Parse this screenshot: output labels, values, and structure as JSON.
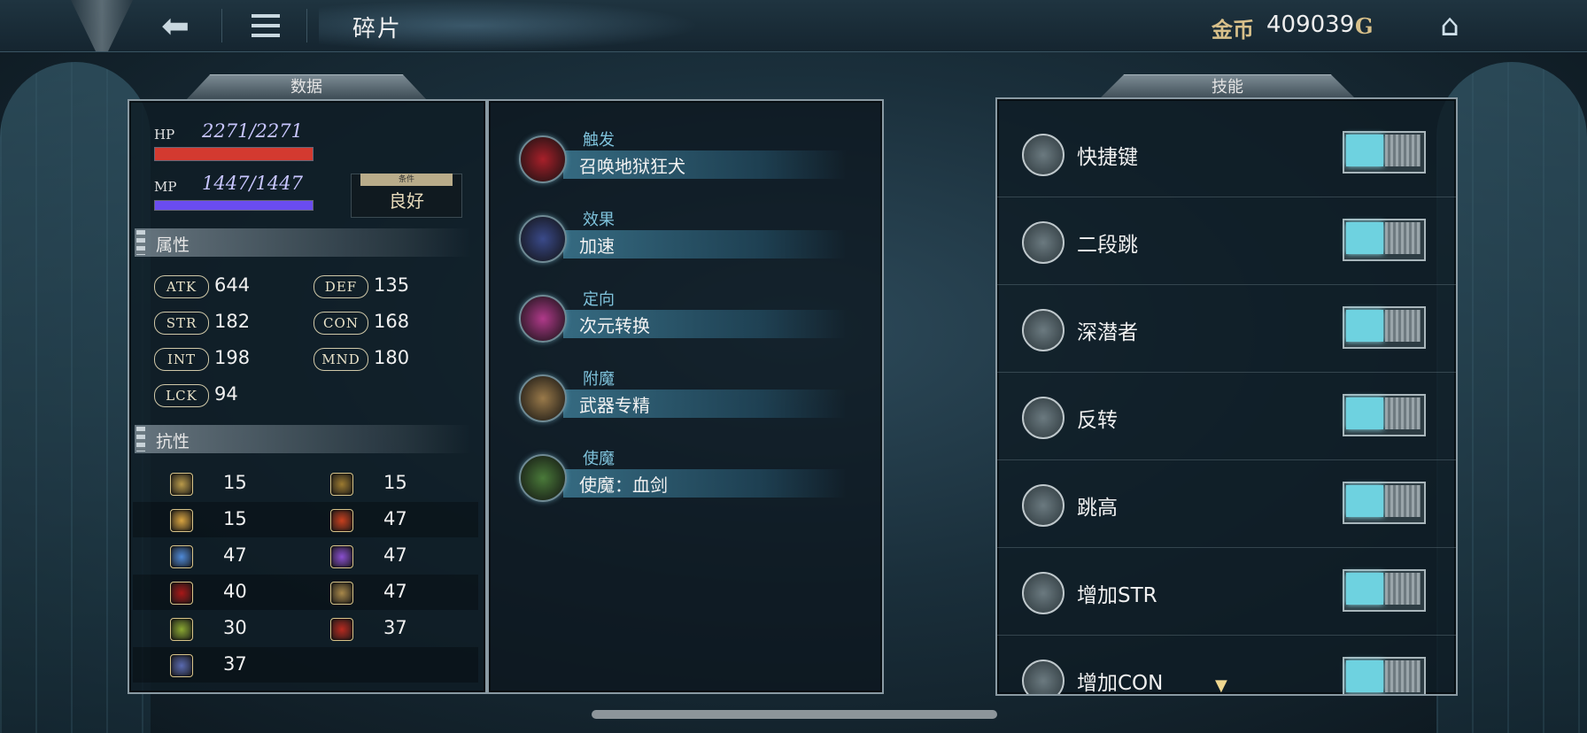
{
  "topbar": {
    "title": "碎片",
    "coin_label": "金币",
    "coin_value": "409039",
    "coin_unit": "G"
  },
  "stats": {
    "tab_label": "数据",
    "hp_label": "HP",
    "hp_value": "2271/2271",
    "hp_fraction": 1.0,
    "hp_color": "#d33a30",
    "mp_label": "MP",
    "mp_value": "1447/1447",
    "mp_fraction": 1.0,
    "mp_color": "#6a4cf0",
    "condition_caption": "条件",
    "condition_value": "良好",
    "attributes_header": "属性",
    "attributes": [
      {
        "label": "ATK",
        "value": "644"
      },
      {
        "label": "DEF",
        "value": "135"
      },
      {
        "label": "STR",
        "value": "182"
      },
      {
        "label": "CON",
        "value": "168"
      },
      {
        "label": "INT",
        "value": "198"
      },
      {
        "label": "MND",
        "value": "180"
      },
      {
        "label": "LCK",
        "value": "94"
      }
    ],
    "resistances_header": "抗性",
    "resistances": [
      {
        "icon": "moon-icon",
        "color": "#b99a4a",
        "value": "15"
      },
      {
        "icon": "arrow-icon",
        "color": "#9c7a30",
        "value": "15"
      },
      {
        "icon": "light-icon",
        "color": "#d9a441",
        "value": "15"
      },
      {
        "icon": "fire-icon",
        "color": "#c8401e",
        "value": "47"
      },
      {
        "icon": "ice-icon",
        "color": "#4f8ad8",
        "value": "47"
      },
      {
        "icon": "lightning-icon",
        "color": "#8a4fd0",
        "value": "47"
      },
      {
        "icon": "blood-icon",
        "color": "#a81818",
        "value": "40"
      },
      {
        "icon": "net-icon",
        "color": "#a8884a",
        "value": "47"
      },
      {
        "icon": "poison-icon",
        "color": "#8aa832",
        "value": "30"
      },
      {
        "icon": "curse-icon",
        "color": "#b82a20",
        "value": "37"
      },
      {
        "icon": "stone-icon",
        "color": "#5a6ab0",
        "value": "37"
      }
    ]
  },
  "fragments": [
    {
      "category": "触发",
      "name": "召唤地狱狂犬",
      "icon": "hellhound-icon",
      "color": "#a8202a"
    },
    {
      "category": "效果",
      "name": "加速",
      "icon": "speed-icon",
      "color": "#3a4a8a"
    },
    {
      "category": "定向",
      "name": "次元转换",
      "icon": "dimension-icon",
      "color": "#b03a8a"
    },
    {
      "category": "附魔",
      "name": "武器专精",
      "icon": "weapon-mastery-icon",
      "color": "#9a7a4a"
    },
    {
      "category": "使魔",
      "name": "使魔：血剑",
      "icon": "blood-sword-icon",
      "color": "#4a7a3a"
    }
  ],
  "skills": {
    "tab_label": "技能",
    "items": [
      {
        "name": "快捷键",
        "icon": "shortcut-icon",
        "enabled": true
      },
      {
        "name": "二段跳",
        "icon": "double-jump-icon",
        "enabled": true
      },
      {
        "name": "深潜者",
        "icon": "deep-diver-icon",
        "enabled": true
      },
      {
        "name": "反转",
        "icon": "reverse-icon",
        "enabled": true
      },
      {
        "name": "跳高",
        "icon": "high-jump-icon",
        "enabled": true
      },
      {
        "name": "增加STR",
        "icon": "str-up-icon",
        "enabled": true
      },
      {
        "name": "增加CON",
        "icon": "con-up-icon",
        "enabled": true
      }
    ]
  }
}
